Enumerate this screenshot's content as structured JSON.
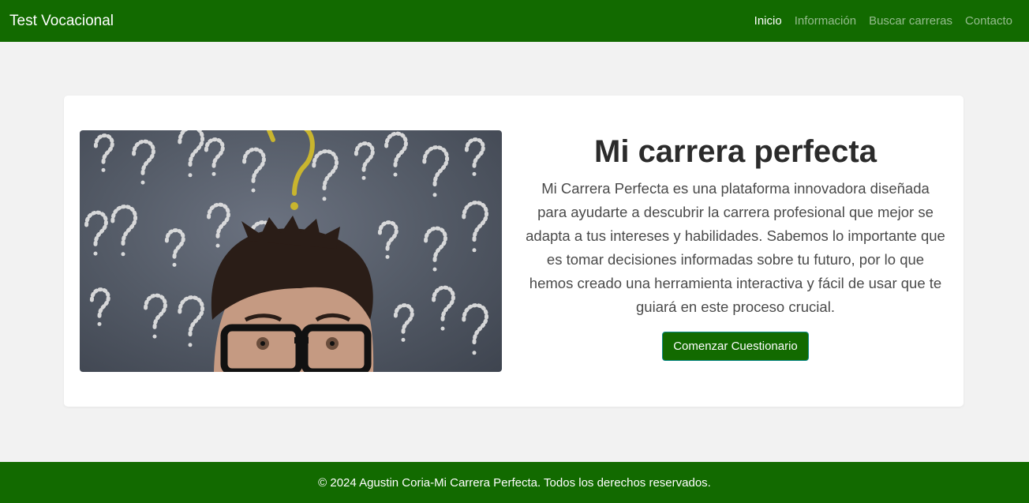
{
  "navbar": {
    "brand": "Test Vocacional",
    "links": [
      {
        "label": "Inicio",
        "active": true
      },
      {
        "label": "Información",
        "active": false
      },
      {
        "label": "Buscar carreras",
        "active": false
      },
      {
        "label": "Contacto",
        "active": false
      }
    ]
  },
  "hero": {
    "title": "Mi carrera perfecta",
    "description": "Mi Carrera Perfecta es una plataforma innovadora diseñada para ayudarte a descubrir la carrera profesional que mejor se adapta a tus intereses y habilidades. Sabemos lo importante que es tomar decisiones informadas sobre tu futuro, por lo que hemos creado una herramienta interactiva y fácil de usar que te guiará en este proceso crucial.",
    "button_label": "Comenzar Cuestionario"
  },
  "footer": {
    "text": "© 2024 Agustin Coria-Mi Carrera Perfecta. Todos los derechos reservados."
  },
  "colors": {
    "primary": "#126a00",
    "page_background": "#f2f2f2",
    "card_background": "#ffffff"
  }
}
